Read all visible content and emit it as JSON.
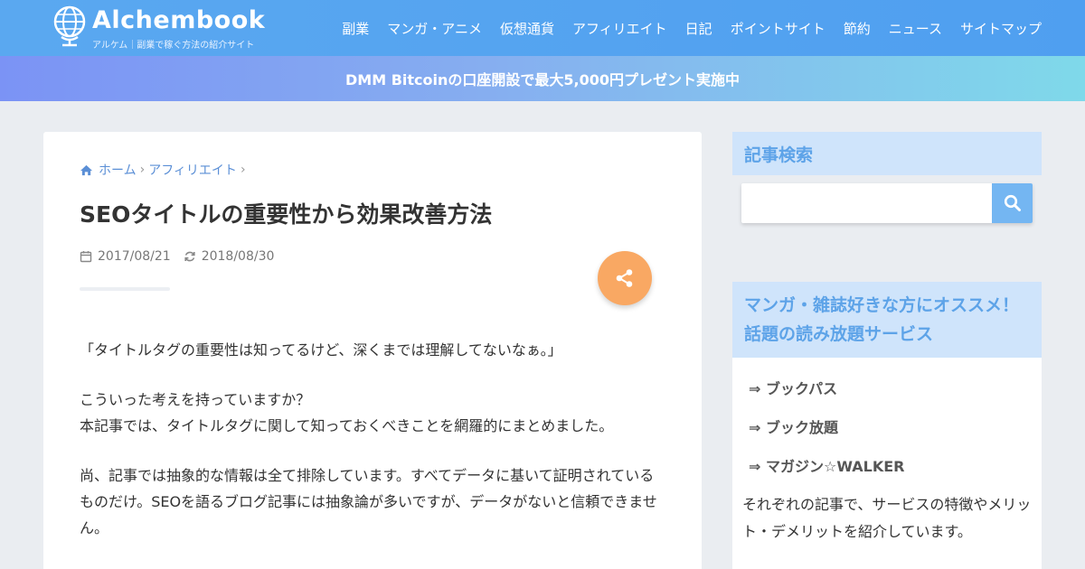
{
  "header": {
    "logo_title": "Alchembook",
    "logo_subtitle": "アルケム｜副業で稼ぐ方法の紹介サイト",
    "nav": [
      "副業",
      "マンガ・アニメ",
      "仮想通貨",
      "アフィリエイト",
      "日記",
      "ポイントサイト",
      "節約",
      "ニュース",
      "サイトマップ"
    ]
  },
  "banner": {
    "text": "DMM Bitcoinの口座開設で最大5,000円プレゼント実施中"
  },
  "article": {
    "breadcrumb": [
      "ホーム",
      "アフィリエイト"
    ],
    "title": "SEOタイトルの重要性から効果改善方法",
    "published": "2017/08/21",
    "updated": "2018/08/30",
    "paragraphs": [
      "「タイトルタグの重要性は知ってるけど、深くまでは理解してないなぁ。」",
      "こういった考えを持っていますか？\n本記事では、タイトルタグに関して知っておくべきことを網羅的にまとめました。",
      "尚、記事では抽象的な情報は全て排除しています。すべてデータに基いて証明されているものだけ。SEOを語るブログ記事には抽象論が多いですが、データがないと信頼できません。"
    ]
  },
  "sidebar": {
    "search_title": "記事検索",
    "search_value": "",
    "widget_title": "マンガ・雑誌好きな方にオススメ！話題の読み放題サービス",
    "links": [
      "⇒ ブックパス",
      "⇒ ブック放題",
      "⇒ マガジン☆WALKER"
    ],
    "description": "それぞれの記事で、サービスの特徴やメリット・デメリットを紹介しています。"
  },
  "colors": {
    "header": "#4f9ff0",
    "accent": "#5da3e8",
    "share_button": "#f9a863",
    "sidebar_head": "#cfe4fb"
  },
  "icons": [
    "globe-icon",
    "home-icon",
    "calendar-icon",
    "refresh-icon",
    "share-icon",
    "search-icon"
  ]
}
